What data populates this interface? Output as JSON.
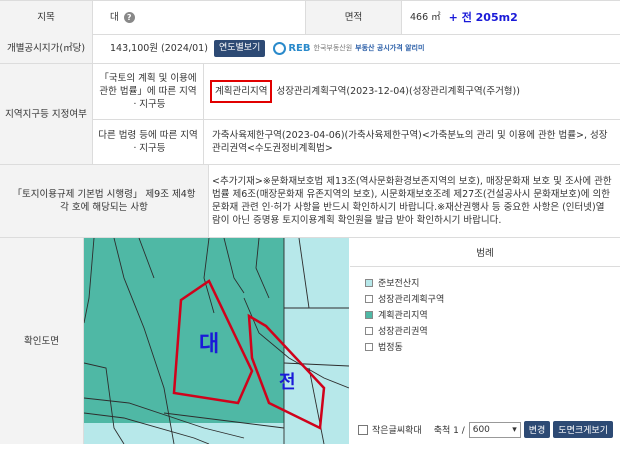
{
  "row1": {
    "land_label": "지목",
    "land_value": "대",
    "help_icon": "?",
    "area_label": "면적",
    "area_value": "466 ㎡",
    "annotation": "+ 전 205m2"
  },
  "row2": {
    "label": "개별공시지가(㎡당)",
    "value": "143,100원 (2024/01)",
    "button": "연도별보기",
    "reb_logo": "REB",
    "reb_text": "한국부동산원",
    "reb_link": "부동산 공시가격 알리미"
  },
  "row3": {
    "label": "지역지구등 지정여부",
    "sub1_label": "「국토의 계획 및 이용에 관한 법률」에 따른 지역ㆍ지구등",
    "sub1_highlight": "계획관리지역",
    "sub1_value": "성장관리계획구역(2023-12-04)(성장관리계획구역(주거형))",
    "sub2_label": "다른 법령 등에 따른 지역ㆍ지구등",
    "sub2_value": "가축사육제한구역(2023-04-06)(가축사육제한구역)<가축분뇨의 관리 및 이용에 관한 법률>, 성장관리권역<수도권정비계획법>"
  },
  "row4": {
    "label": "「토지이용규제 기본법 시행령」 제9조 제4항 각 호에 해당되는 사항",
    "value": "<추가기재>※문화재보호법 제13조(역사문화환경보존지역의 보호), 매장문화재 보호 및 조사에 관한 법률 제6조(매장문화재 유존지역의 보호), 시문화재보호조례 제27조(건설공사시 문화재보호)에 의한 문화재 관련 인·허가 사항을 반드시 확인하시기 바랍니다.※재산권행사 등 중요한 사항은 (인터넷)열람이 아닌 증명용 토지이용계획 확인원을 발급 받아 확인하시기 바랍니다."
  },
  "row5": {
    "label": "확인도면",
    "map_label1": "대",
    "map_label2": "전",
    "legend_title": "범례",
    "legend_items": [
      "준보전산지",
      "성장관리계획구역",
      "계획관리지역",
      "성장관리권역",
      "법정동"
    ],
    "legend_colors": [
      "#b7e8ea",
      "#ffffff",
      "#4fb8a5",
      "#ffffff",
      "#ffffff"
    ],
    "zoom_checkbox": "작은글씨확대",
    "scale_label": "축척 1 /",
    "scale_value": "600",
    "change_button": "변경",
    "print_button": "도면크게보기"
  }
}
